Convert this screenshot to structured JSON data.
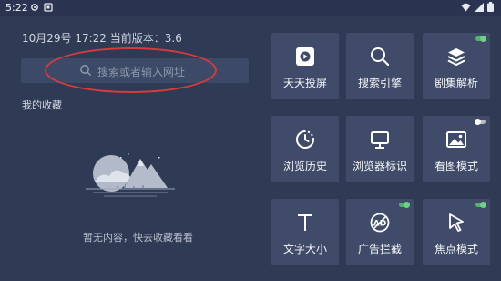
{
  "status_bar": {
    "time": "5:22"
  },
  "info": {
    "datetime": "10月29号 17:22  当前版本：3.6"
  },
  "search": {
    "placeholder": "搜索或者输入网址"
  },
  "favorites": {
    "title": "我的收藏",
    "empty_text": "暂无内容，快去收藏看看"
  },
  "tiles": [
    {
      "label": "天天投屏",
      "icon": "screen-cast-icon",
      "toggle": null
    },
    {
      "label": "搜索引擎",
      "icon": "search-icon",
      "toggle": null
    },
    {
      "label": "剧集解析",
      "icon": "layers-icon",
      "toggle": "on"
    },
    {
      "label": "浏览历史",
      "icon": "history-icon",
      "toggle": null
    },
    {
      "label": "浏览器标识",
      "icon": "monitor-icon",
      "toggle": null
    },
    {
      "label": "看图模式",
      "icon": "image-icon",
      "toggle": "off"
    },
    {
      "label": "文字大小",
      "icon": "text-size-icon",
      "toggle": null
    },
    {
      "label": "广告拦截",
      "icon": "ad-block-icon",
      "toggle": "on"
    },
    {
      "label": "焦点模式",
      "icon": "cursor-icon",
      "toggle": "on"
    }
  ],
  "colors": {
    "background": "#2f3a55",
    "tile": "#3f4b68",
    "annotation": "#d93b3b",
    "toggle_on": "#4fb36a"
  }
}
